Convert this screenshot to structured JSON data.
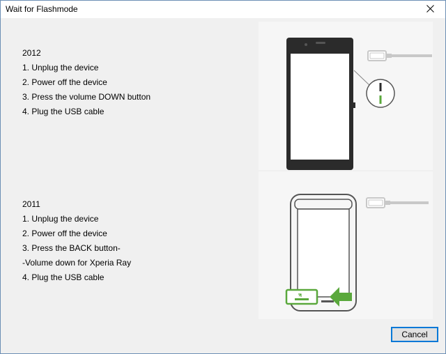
{
  "window": {
    "title": "Wait for Flashmode"
  },
  "section_2012": {
    "year": "2012",
    "steps": [
      "1.  Unplug the device",
      "2.  Power off the device",
      "3.  Press the volume DOWN button",
      "4.  Plug the USB cable"
    ]
  },
  "section_2011": {
    "year": "2011",
    "steps": [
      "1.  Unplug the device",
      "2.  Power off the device",
      "3.  Press the BACK button-",
      "-Volume down for Xperia Ray",
      "4.  Plug the USB cable"
    ]
  },
  "footer": {
    "cancel_label": "Cancel"
  },
  "colors": {
    "accent_green": "#5aa83c",
    "focus_blue": "#0078d7",
    "phone_dark": "#2b2b2b",
    "cable_gray": "#c8c8c8"
  },
  "icons": {
    "close": "close-icon",
    "illustration_2012": "phone-volume-down-illustration",
    "illustration_2011": "phone-back-button-illustration"
  }
}
